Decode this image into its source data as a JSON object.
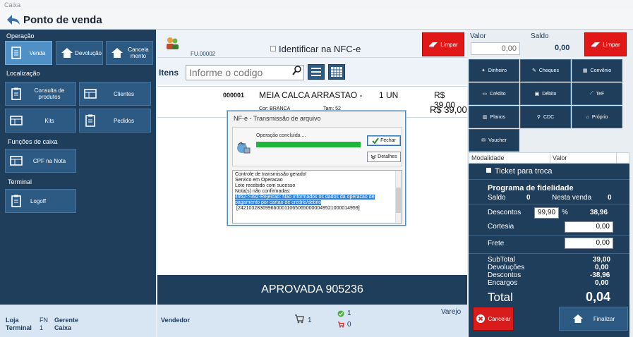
{
  "window": {
    "title": "Caixa"
  },
  "header": {
    "title": "Ponto de venda"
  },
  "left": {
    "operacao": "Operação",
    "venda": "Venda",
    "devolucao": "Devolução",
    "cancelamento": "Cancela mento",
    "localizacao": "Localização",
    "consulta": "Consulta de produtos",
    "clientes": "Clientes",
    "kits": "Kits",
    "pedidos": "Pedidos",
    "funcoes": "Funções de caixa",
    "cpf": "CPF na Nota",
    "terminal_sect": "Terminal",
    "logoff": "Logoff"
  },
  "leftfoot": {
    "loja_lbl": "Loja",
    "loja_val": "FN",
    "gerente": "Gerente",
    "terminal_lbl": "Terminal",
    "terminal_val": "1",
    "caixa": "Caixa"
  },
  "center": {
    "fu": "FU.00002",
    "nfce": "Identificar na NFC-e",
    "limpar": "Limpar",
    "itens": "Itens",
    "search_placeholder": "Informe o codigo",
    "item": {
      "code": "000001",
      "desc": "MEIA CALCA ARRASTAO -",
      "qty": "1 UN",
      "price": "R$ 39,00",
      "cor": "Cor: BRANCA",
      "tam": "Tam: 52",
      "total": "R$ 39,00"
    },
    "approved": "APROVADA 905236",
    "vendedor": "Vendedor",
    "varejo": "Varejo",
    "count_items": "1",
    "count_ok": "1",
    "count_cart": "0"
  },
  "dialog": {
    "title": "NF-e - Transmissão de arquivo",
    "status": "Operação concluída ...",
    "fechar": "Fechar",
    "detalhes": "Detalhes",
    "log1": "Controle de transmissão gerado!",
    "log2": "Servico em Operacao",
    "log3": "Lote recebido com sucesso",
    "log4": "Nota(s) não confirmadas:",
    "log5": "4952->392-Rejeicao: Nao informados os dados da operacao de",
    "log6": "pagamento por cartao de credito/debito",
    "log7": "[24210328369966000110650650000049521000014959]"
  },
  "right": {
    "valor_lbl": "Valor",
    "saldo_lbl": "Saldo",
    "valor_val": "0,00",
    "saldo_val": "0,00",
    "limpar": "Limpar",
    "pay": [
      "Dinheiro",
      "Cheques",
      "Convênio",
      "Crédito",
      "Débito",
      "TeF",
      "Planos",
      "CDC",
      "Próprio",
      "Voucher"
    ],
    "modalidade": "Modalidade",
    "valor_col": "Valor",
    "ticket": "Ticket para troca",
    "fidelidade": "Programa de fidelidade",
    "saldo": "Saldo",
    "saldo_n": "0",
    "nesta_venda": "Nesta venda",
    "nesta_n": "0",
    "descontos_lbl": "Descontos",
    "desc_pct": "99,90",
    "pct": "%",
    "desc_val": "38,96",
    "cortesia": "Cortesia",
    "cortesia_val": "0,00",
    "frete": "Frete",
    "frete_val": "0,00",
    "subtotal": "SubTotal",
    "subtotal_v": "39,00",
    "devolucoes": "Devoluções",
    "devolucoes_v": "0,00",
    "descontos": "Descontos",
    "descontos_v": "-38,96",
    "encargos": "Encargos",
    "encargos_v": "0,00",
    "total": "Total",
    "total_v": "0,04",
    "cancelar": "Cancelar",
    "finalizar": "Finalizar"
  },
  "colors": {
    "navy": "#1f3e5c",
    "red": "#e01818",
    "green": "#1fb43a",
    "blue": "#2d5a82"
  }
}
